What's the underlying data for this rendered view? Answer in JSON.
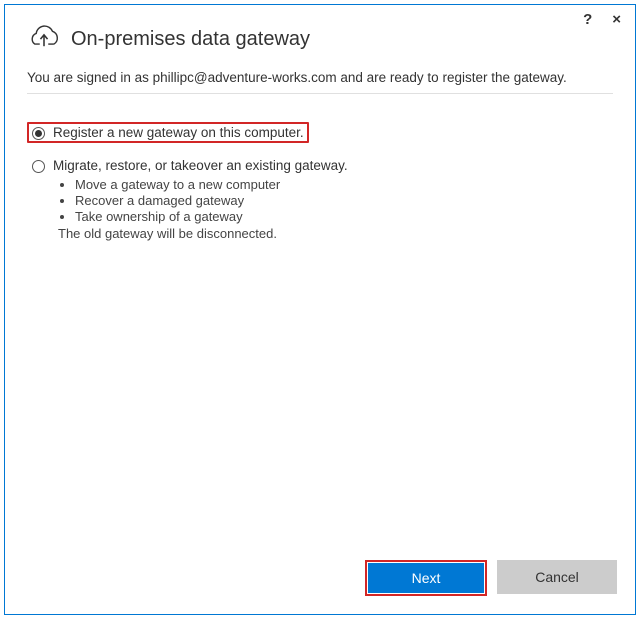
{
  "window": {
    "help_tooltip": "?",
    "close_tooltip": "×"
  },
  "header": {
    "title": "On-premises data gateway",
    "subtitle_prefix": "You are signed in as ",
    "subtitle_email": "phillipc@adventure-works.com",
    "subtitle_suffix": " and are ready to register the gateway."
  },
  "options": {
    "register": {
      "label": "Register a new gateway on this computer.",
      "selected": true
    },
    "migrate": {
      "label": "Migrate, restore, or takeover an existing gateway.",
      "bullets": [
        "Move a gateway to a new computer",
        "Recover a damaged gateway",
        "Take ownership of a gateway"
      ],
      "note": "The old gateway will be disconnected.",
      "selected": false
    }
  },
  "buttons": {
    "next": "Next",
    "cancel": "Cancel"
  }
}
